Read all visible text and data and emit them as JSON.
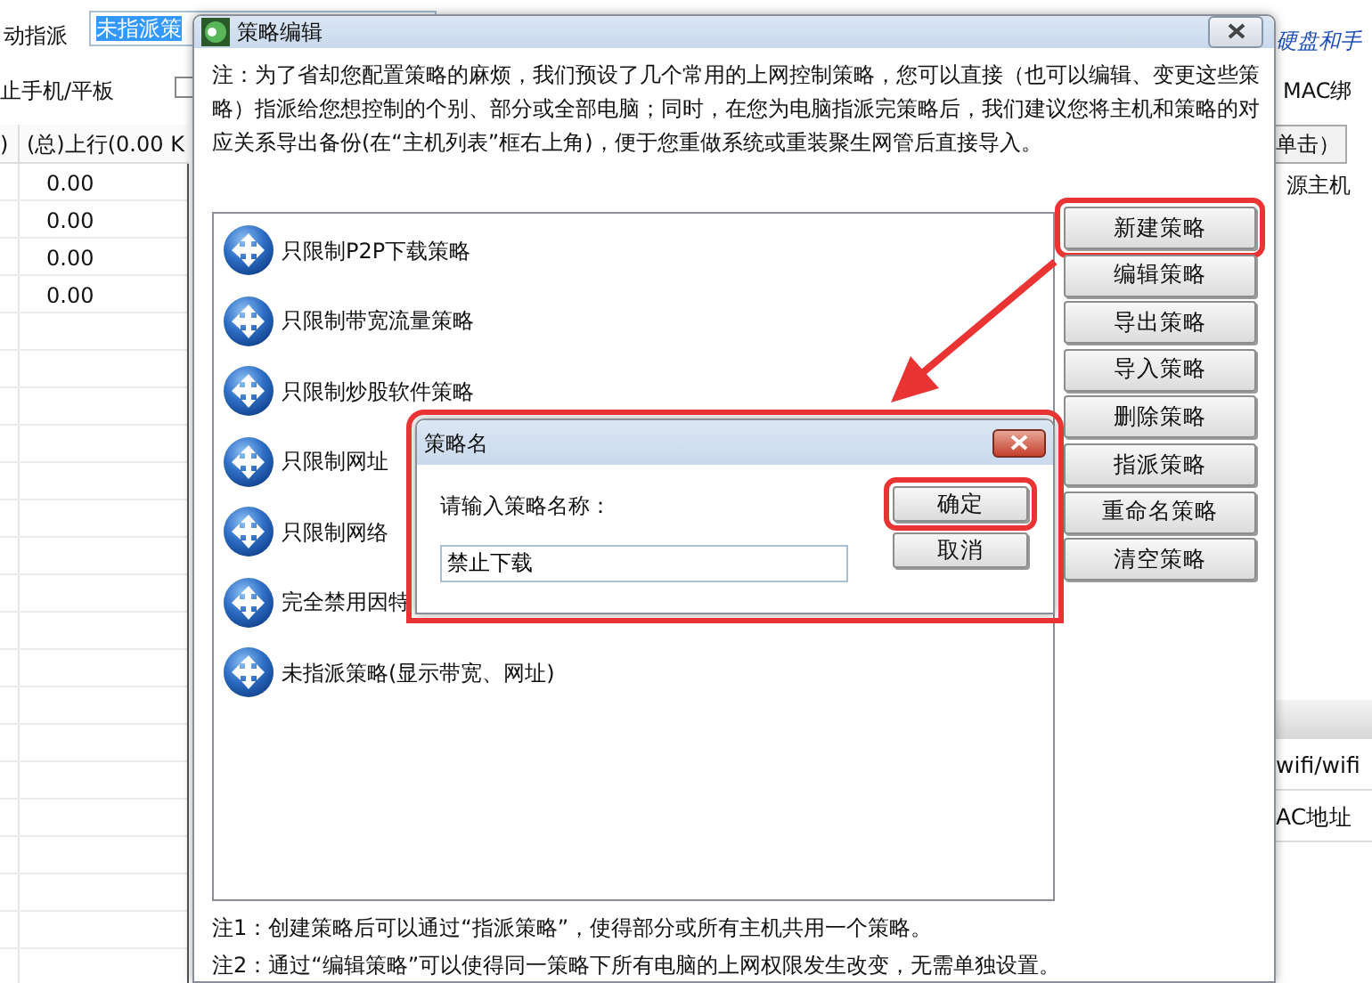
{
  "background_window": {
    "assign_label": "动指派",
    "policy_field": {
      "value": "未指派策",
      "selected": true
    },
    "device_label": "止手机/平板",
    "device_checkbox": {
      "checked": false
    },
    "right_link": "硬盘和手",
    "mac_label": "MAC绑",
    "table": {
      "columns": [
        ")",
        "(总)上行(0.00 K"
      ],
      "rows": [
        [
          "",
          "0.00"
        ],
        [
          "",
          "0.00"
        ],
        [
          "",
          "0.00"
        ],
        [
          "",
          "0.00"
        ]
      ]
    },
    "right_tab": "单击）",
    "right_column": "源主机",
    "right_panel_rows": [
      "wifi/wifi",
      "AC地址"
    ]
  },
  "dialog": {
    "title": "策略编辑",
    "note": "注：为了省却您配置策略的麻烦，我们预设了几个常用的上网控制策略，您可以直接（也可以编辑、变更这些策略）指派给您想控制的个别、部分或全部电脑；同时，在您为电脑指派完策略后，我们建议您将主机和策略的对应关系导出备份(在“主机列表”框右上角)，便于您重做系统或重装聚生网管后直接导入。",
    "policies": [
      {
        "label": "只限制P2P下载策略"
      },
      {
        "label": "只限制带宽流量策略"
      },
      {
        "label": "只限制炒股软件策略"
      },
      {
        "label": "只限制网址"
      },
      {
        "label": "只限制网络"
      },
      {
        "label": "完全禁用因特"
      },
      {
        "label": "未指派策略(显示带宽、网址)"
      }
    ],
    "buttons": [
      {
        "label": "新建策略",
        "highlighted": true
      },
      {
        "label": "编辑策略",
        "highlighted": false
      },
      {
        "label": "导出策略",
        "highlighted": false
      },
      {
        "label": "导入策略",
        "highlighted": false
      },
      {
        "label": "删除策略",
        "highlighted": false
      },
      {
        "label": "指派策略",
        "highlighted": false
      },
      {
        "label": "重命名策略",
        "highlighted": false
      },
      {
        "label": "清空策略",
        "highlighted": false
      }
    ],
    "footnotes": [
      "注1：创建策略后可以通过“指派策略”，使得部分或所有主机共用一个策略。",
      "注2：通过“编辑策略”可以使得同一策略下所有电脑的上网权限发生改变，无需单独设置。"
    ]
  },
  "name_dialog": {
    "title": "策略名",
    "highlighted": true,
    "prompt": "请输入策略名称：",
    "value": "禁止下载",
    "buttons": [
      {
        "label": "确定",
        "highlighted": true
      },
      {
        "label": "取消",
        "highlighted": false
      }
    ]
  }
}
